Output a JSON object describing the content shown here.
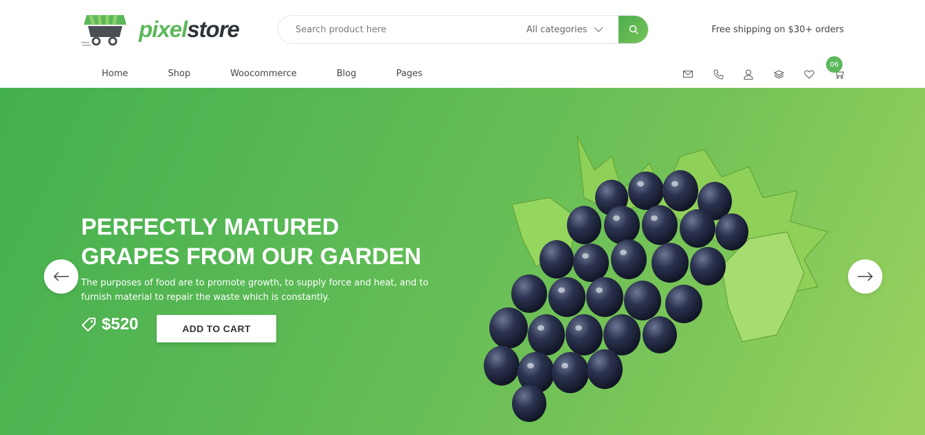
{
  "header": {
    "logo": {
      "part1": "pixel",
      "part2": "store"
    },
    "search": {
      "placeholder": "Search product here",
      "category": "All categories"
    },
    "shipping": "Free shipping on $30+ orders",
    "nav": [
      "Home",
      "Shop",
      "Woocommerce",
      "Blog",
      "Pages"
    ],
    "icons": [
      "mail-icon",
      "phone-icon",
      "user-icon",
      "layers-icon",
      "heart-icon",
      "cart-icon"
    ],
    "cart_count": "06"
  },
  "hero": {
    "headline_line1": "PERFECTLY MATURED",
    "headline_line2": "GRAPES FROM OUR GARDEN",
    "description_line1": "The purposes of food are to promote growth, to supply force and heat, and to",
    "description_line2": "furnish material to repair the waste which is constantly.",
    "price": "$520",
    "cta": "ADD TO CART"
  },
  "colors": {
    "accent": "#5cb85c",
    "hero_start": "#44b04d",
    "hero_end": "#9bd25f",
    "dark": "#2d3338"
  }
}
